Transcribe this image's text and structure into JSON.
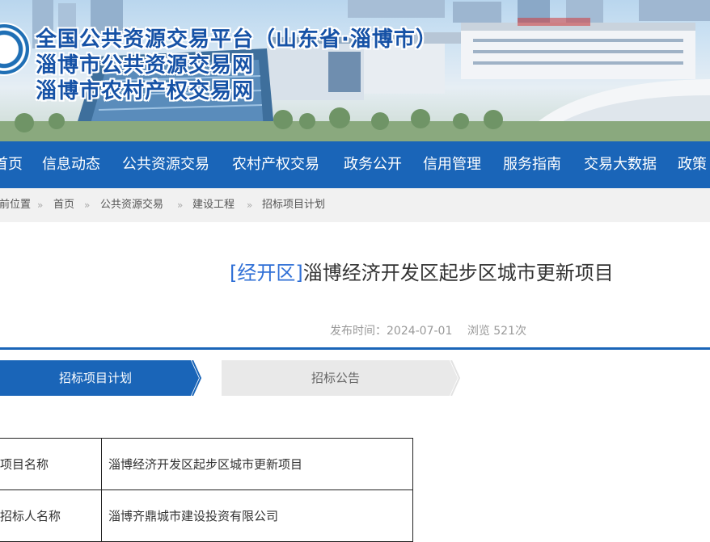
{
  "banner": {
    "title_line1": "全国公共资源交易平台（山东省·淄博市）",
    "title_line2": "淄博市公共资源交易网",
    "title_line3": "淄博市农村产权交易网"
  },
  "nav": {
    "items": [
      "首页",
      "信息动态",
      "公共资源交易",
      "农村产权交易",
      "政务公开",
      "信用管理",
      "服务指南",
      "交易大数据",
      "政策"
    ]
  },
  "breadcrumb": {
    "items": [
      "当前位置",
      "首页",
      "公共资源交易",
      "建设工程",
      "招标项目计划"
    ],
    "separator": "»"
  },
  "article": {
    "region_tag": "[经开区]",
    "title": "淄博经济开发区起步区城市更新项目",
    "publish_label": "发布时间：2024-07-01",
    "views_label": "浏览 521次"
  },
  "steps": {
    "active": "招标项目计划",
    "next": "招标公告"
  },
  "info": {
    "rows": [
      {
        "key": "项目名称",
        "value": "淄博经济开发区起步区城市更新项目"
      },
      {
        "key": "招标人名称",
        "value": "淄博齐鼎城市建设投资有限公司"
      }
    ]
  },
  "colors": {
    "primary": "#1a65b8",
    "region_link": "#2f6fd6",
    "breadcrumb_bg": "#f1f1f1",
    "tab_inactive": "#e9e9e9"
  }
}
